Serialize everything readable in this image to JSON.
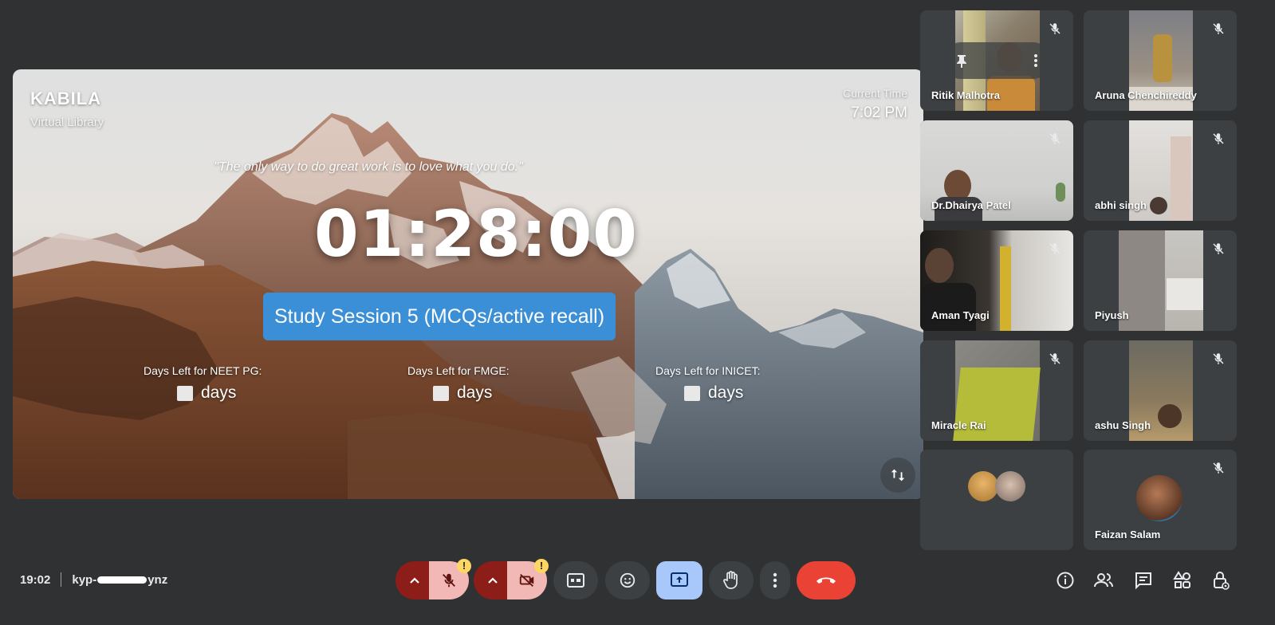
{
  "presentation": {
    "brand_name": "KABILA",
    "brand_subtitle": "Virtual Library",
    "current_time_label": "Current Time",
    "current_time_value": "7:02 PM",
    "quote": "\"The only way to do great work is to love what you do.\"",
    "timer": "01:28:00",
    "session_label": "Study Session 5 (MCQs/active recall)",
    "countdowns": [
      {
        "label": "Days Left for NEET PG:",
        "unit": "days"
      },
      {
        "label": "Days Left for FMGE:",
        "unit": "days"
      },
      {
        "label": "Days Left for INICET:",
        "unit": "days"
      }
    ]
  },
  "participants": [
    {
      "name": "Ritik Malhotra",
      "muted": true,
      "pinned_controls": true
    },
    {
      "name": "Aruna Chenchireddy",
      "muted": true
    },
    {
      "name": "Dr.Dhairya Patel",
      "muted": true
    },
    {
      "name": "abhi singh",
      "muted": true
    },
    {
      "name": "Aman Tyagi",
      "muted": true
    },
    {
      "name": "Piyush",
      "muted": true
    },
    {
      "name": "Miracle Rai",
      "muted": true
    },
    {
      "name": "ashu Singh",
      "muted": true
    },
    {
      "name": "",
      "muted": false
    },
    {
      "name": "Faizan Salam",
      "muted": true
    }
  ],
  "bottom_bar": {
    "time": "19:02",
    "meeting_code_start": "kyp-",
    "meeting_code_end": "ynz",
    "warning_mark": "!"
  },
  "colors": {
    "background": "#2f3133",
    "tile": "#3c4043",
    "end_call": "#ea4335",
    "muted_red": "#8c1d18",
    "present_active": "#a8c7fa",
    "session_blue": "#3a8fd6",
    "warning": "#fdd663"
  },
  "icons": [
    "pin-icon",
    "more-vert-icon",
    "mic-off-icon",
    "swap-icon",
    "chevron-up-icon",
    "videocam-off-icon",
    "captions-icon",
    "emoji-icon",
    "present-icon",
    "raise-hand-icon",
    "call-end-icon",
    "info-icon",
    "people-icon",
    "chat-icon",
    "activities-icon",
    "host-controls-icon"
  ]
}
